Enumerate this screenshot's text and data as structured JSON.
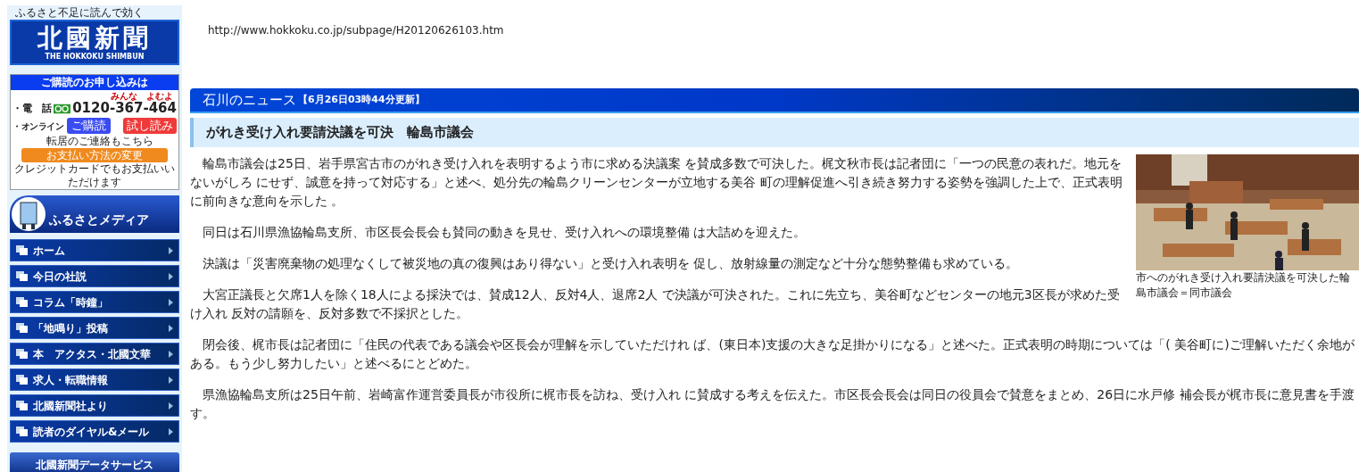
{
  "sidebar": {
    "tagline": "ふるさと不足に読んで効く",
    "logo": {
      "title": "北國新聞",
      "subtitle": "THE HOKKOKU SHIMBUN"
    },
    "subscribe": {
      "heading": "ご購読のお申し込みは",
      "phone_label": "・電　話",
      "phone": "0120-367-464",
      "phone_ruby": [
        "みんな",
        "よむよ"
      ],
      "online_label": "・オンライン",
      "subscribe_button": "ご購読",
      "trial_button": "試し読み",
      "moving_note": "転居のご連絡もこちら",
      "payment_button": "お支払い方法の変更",
      "card_note": "クレジットカードでもお支払いいただけます"
    },
    "media_banner": "ふるさとメディア",
    "items": [
      {
        "label": "ホーム"
      },
      {
        "label": "今日の社説"
      },
      {
        "label": "コラム「時鐘」"
      },
      {
        "label": "「地鳴り」投稿"
      },
      {
        "label": "本　アクタス・北國文華"
      },
      {
        "label": "求人・転職情報"
      },
      {
        "label": "北國新聞社より"
      },
      {
        "label": "読者のダイヤル&メール"
      }
    ],
    "data_service": "北國新聞データサービス"
  },
  "url": "http://www.hokkoku.co.jp/subpage/H20120626103.htm",
  "section": {
    "title": "石川のニュース",
    "updated": "【6月26日03時44分更新】"
  },
  "article": {
    "headline": "がれき受け入れ要請決議を可決　輪島市議会",
    "photo": {
      "kind": "picture",
      "caption": "市へのがれき受け入れ要請決議を可決した輪島市議会＝同市議会"
    },
    "paragraphs": [
      "　輪島市議会は25日、岩手県宮古市のがれき受け入れを表明するよう市に求める決議案 を賛成多数で可決した。梶文秋市長は記者団に「一つの民意の表れだ。地元をないがしろ にせず、誠意を持って対応する」と述べ、処分先の輪島クリーンセンターが立地する美谷 町の理解促進へ引き続き努力する姿勢を強調した上で、正式表明に前向きな意向を示した 。",
      "　同日は石川県漁協輪島支所、市区長会長会も賛同の動きを見せ、受け入れへの環境整備 は大詰めを迎えた。",
      "　決議は「災害廃棄物の処理なくして被災地の真の復興はあり得ない」と受け入れ表明を 促し、放射線量の測定など十分な態勢整備も求めている。",
      "　大宮正議長と欠席1人を除く18人による採決では、賛成12人、反対4人、退席2人 で決議が可決された。これに先立ち、美谷町などセンターの地元3区長が求めた受け入れ 反対の請願を、反対多数で不採択とした。",
      "　閉会後、梶市長は記者団に「住民の代表である議会や区長会が理解を示していただけれ ば、(東日本)支援の大きな足掛かりになる」と述べた。正式表明の時期については「( 美谷町に)ご理解いただく余地がある。もう少し努力したい」と述べるにとどめた。",
      "　県漁協輪島支所は25日午前、岩崎富作運営委員長が市役所に梶市長を訪ね、受け入れ に賛成する考えを伝えた。市区長会長会は同日の役員会で賛意をまとめ、26日に水戸修 補会長が梶市長に意見書を手渡す。"
    ]
  }
}
